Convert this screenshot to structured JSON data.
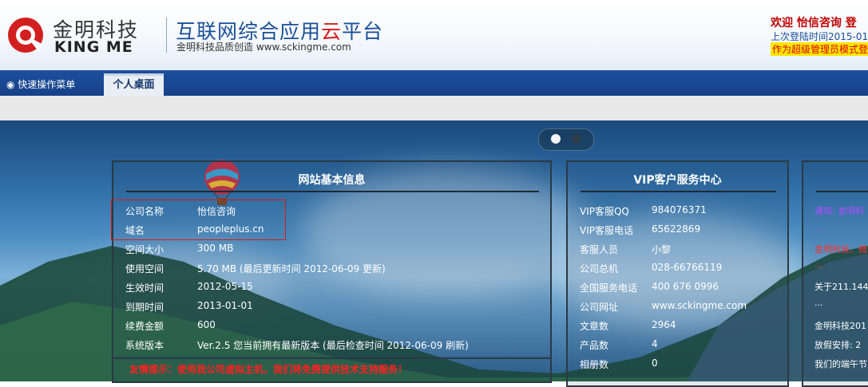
{
  "header": {
    "brand_cn": "金明科技",
    "brand_en": "KING ME",
    "slogan_main": "互联网综合应用",
    "slogan_highlight": "云",
    "slogan_tail": "平台",
    "sub_slogan": "金明科技品质创造   www.sckingme.com",
    "welcome": "欢迎  怡信咨询  登",
    "last_login": "上次登陆时间2015-01",
    "admin_notice": "作为超级管理员模式登",
    "colors": {
      "brand_blue": "#1a4f9a",
      "accent_red": "#d31f1f"
    }
  },
  "nav": {
    "quick_menu": "◉ 快速操作菜单",
    "tabs": [
      {
        "label": "个人桌面",
        "active": true
      }
    ]
  },
  "site_info": {
    "title": "网站基本信息",
    "rows": [
      {
        "label": "公司名称",
        "value": "怡信咨询"
      },
      {
        "label": "域名",
        "value": "peopleplus.cn"
      },
      {
        "label": "空间大小",
        "value": "300 MB"
      },
      {
        "label": "使用空间",
        "value": "5.70 MB (最后更新时间 2012-06-09 更新)"
      },
      {
        "label": "生效时间",
        "value": "2012-05-15"
      },
      {
        "label": "到期时间",
        "value": "2013-01-01"
      },
      {
        "label": "续费金额",
        "value": "600"
      },
      {
        "label": "系统版本",
        "value": "Ver.2.5 您当前拥有最新版本 (最后检查时间 2012-06-09 刷新)"
      }
    ],
    "tip": "友情提示：使用我公司虚拟主机，我们将免费提供技术支持服务！"
  },
  "vip_service": {
    "title": "VIP客户服务中心",
    "rows": [
      {
        "label": "VIP客服QQ",
        "value": "984076371"
      },
      {
        "label": "VIP客服电话",
        "value": "65622869"
      },
      {
        "label": "客服人员",
        "value": "小黎"
      },
      {
        "label": "公司总机",
        "value": "028-66766119"
      },
      {
        "label": "全国服务电话",
        "value": "400 676 0996"
      },
      {
        "label": "公司网址",
        "value": "www.sckingme.com"
      },
      {
        "label": "文章数",
        "value": "2964"
      },
      {
        "label": "产品数",
        "value": "4"
      },
      {
        "label": "相册数",
        "value": "0"
      }
    ]
  },
  "notices": {
    "items": [
      {
        "text": "通知: 金明科",
        "color": "#b44cff"
      },
      {
        "text": "...",
        "color": "#b44cff"
      },
      {
        "text": "金明科技、微",
        "color": "#ff3030"
      },
      {
        "text": "...",
        "color": "#ff3030"
      },
      {
        "text": "关于211.144",
        "color": "#ffffff"
      },
      {
        "text": "...",
        "color": "#ffffff"
      },
      {
        "text": "金明科技201",
        "color": "#ffffff"
      },
      {
        "text": "放假安排: 2",
        "color": "#ffffff"
      },
      {
        "text": "我们的端午节",
        "color": "#ffffff"
      }
    ]
  }
}
